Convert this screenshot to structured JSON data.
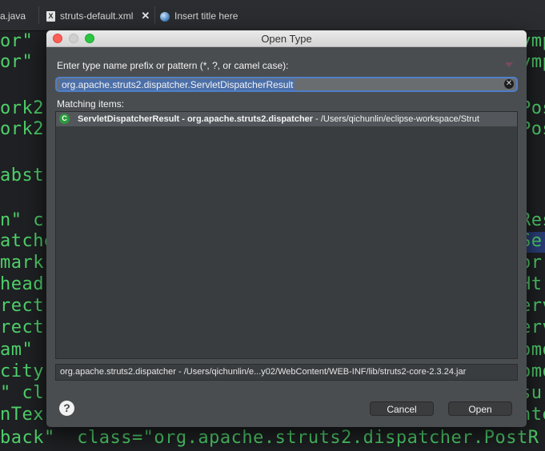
{
  "tabs": [
    {
      "label": "a.java"
    },
    {
      "label": "struts-default.xml",
      "icon": "xml-file-icon",
      "close": "✕"
    },
    {
      "label": "Insert title here",
      "icon": "globe-icon"
    }
  ],
  "editor": {
    "left_fragments": [
      "or\"",
      "or\"",
      "ork2",
      "ork2",
      "abst",
      "n\" c",
      "atche",
      "mark",
      "head",
      "rect",
      "rect",
      "am\"",
      "city",
      "\" cl",
      "nTex",
      "back\"  class=\"org.apache.struts2.dispatcher.PostR"
    ],
    "right_fragments": [
      "ymp",
      "ymp",
      "Post",
      "Post",
      "Res",
      "Se",
      "orr",
      "Ht",
      "erv",
      "erv",
      "omo",
      "omo",
      "su",
      "nte"
    ]
  },
  "dialog": {
    "title": "Open Type",
    "prompt": "Enter type name prefix or pattern (*, ?, or camel case):",
    "search_value": "org.apache.struts2.dispatcher.ServletDispatcherResult",
    "matching_label": "Matching items:",
    "items": [
      {
        "name": "ServletDispatcherResult",
        "separator": " - ",
        "package": "org.apache.struts2.dispatcher",
        "path": " - /Users/qichunlin/eclipse-workspace/Strut",
        "icon": "class-icon",
        "icon_glyph": "C"
      }
    ],
    "status": "org.apache.struts2.dispatcher - /Users/qichunlin/e...y02/WebContent/WEB-INF/lib/struts2-core-2.3.24.jar",
    "help_glyph": "?",
    "cancel_label": "Cancel",
    "open_label": "Open"
  },
  "colors": {
    "accent": "#4f7fc8",
    "code_green": "#4fd06a",
    "dialog_bg": "#4a4d50"
  }
}
